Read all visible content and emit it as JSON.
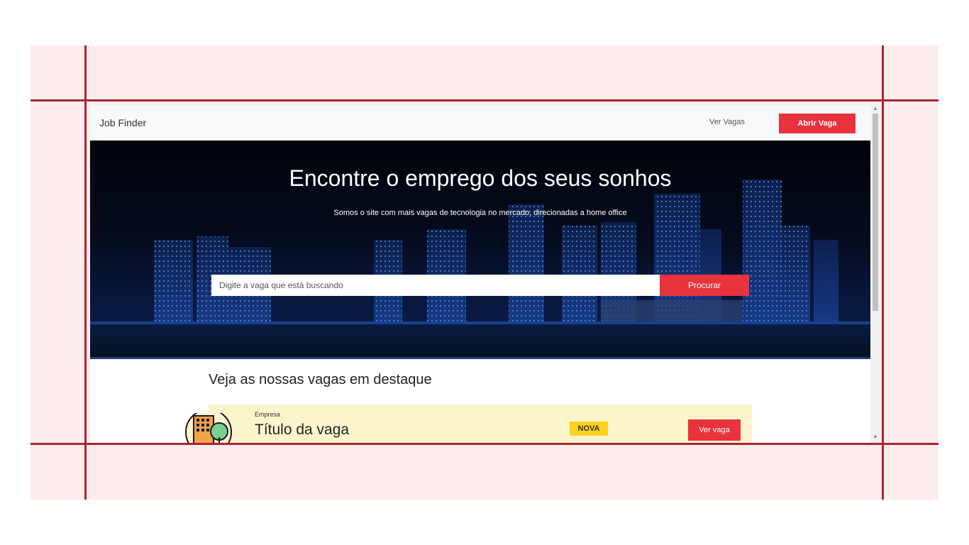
{
  "app": {
    "brand": "Job Finder",
    "nav_link": "Ver Vagas",
    "nav_button": "Abrir Vaga"
  },
  "hero": {
    "title": "Encontre o emprego dos seus sonhos",
    "subtitle": "Somos o site com mais vagas de tecnologia no mercado, direcionadas a home office",
    "search_placeholder": "Digite a vaga que está buscando",
    "search_button": "Procurar"
  },
  "featured": {
    "title": "Veja as nossas vagas em destaque",
    "jobs": [
      {
        "company": "Empresa",
        "title": "Título da vaga",
        "badge": "NOVA",
        "action": "Ver vaga"
      }
    ]
  },
  "colors": {
    "accent": "#e8333c",
    "badge": "#ffd21f",
    "card": "#fcf5cc",
    "guide": "#a8252f",
    "frame": "#fdeced"
  },
  "icons": [
    "building-avatar-icon",
    "scroll-up-icon",
    "scroll-down-icon"
  ]
}
